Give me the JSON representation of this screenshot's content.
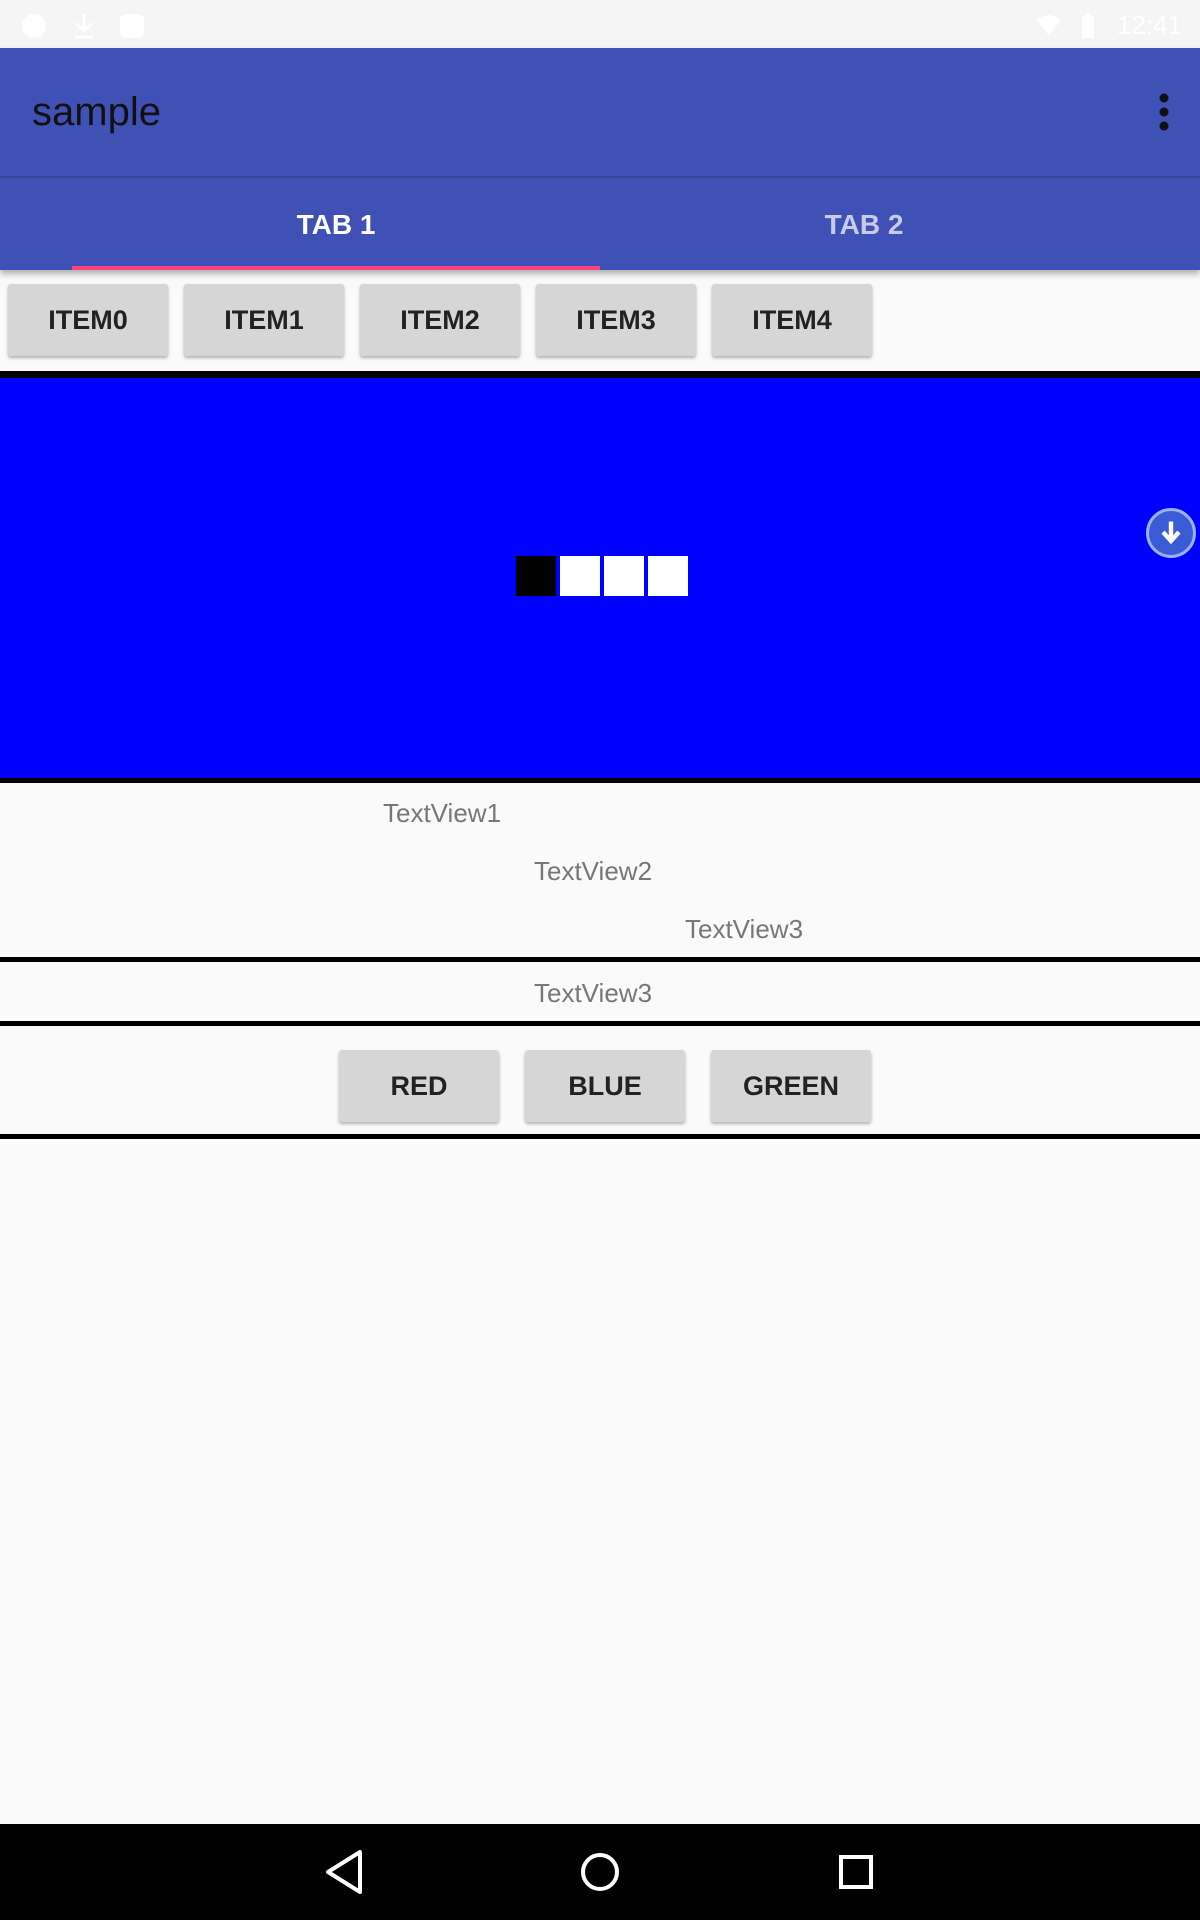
{
  "status_bar": {
    "time": "12:41"
  },
  "app_bar": {
    "title": "sample"
  },
  "tabs": [
    {
      "label": "TAB 1",
      "selected": true
    },
    {
      "label": "TAB 2",
      "selected": false
    }
  ],
  "item_buttons": [
    "ITEM0",
    "ITEM1",
    "ITEM2",
    "ITEM3",
    "ITEM4"
  ],
  "pager": {
    "page_count": 4,
    "current_page": 1
  },
  "text_views": {
    "tv1": "TextView1",
    "tv2": "TextView2",
    "tv3": "TextView3",
    "tv3_centered": "TextView3"
  },
  "color_buttons": [
    "RED",
    "BLUE",
    "GREEN"
  ],
  "colors": {
    "primary": "#3f51b5",
    "accent": "#ff4081",
    "panel": "#0000ff"
  },
  "icons": {
    "overflow": "more-vert-icon",
    "scroll": "arrow-down-circle-icon",
    "nav_back": "back-triangle-icon",
    "nav_home": "home-circle-icon",
    "nav_recents": "recents-square-icon"
  }
}
